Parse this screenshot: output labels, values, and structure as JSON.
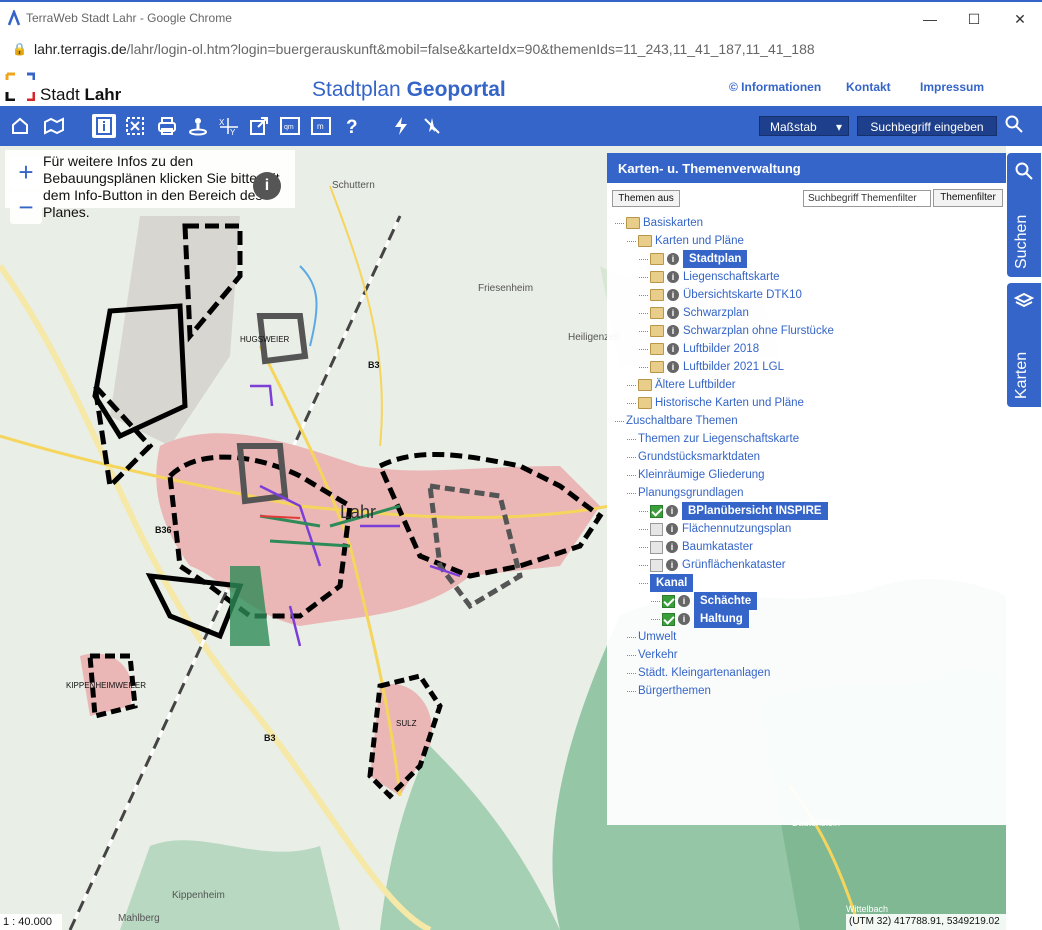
{
  "browser": {
    "window_title": "TerraWeb Stadt Lahr - Google Chrome",
    "url_host": "lahr.terragis.de",
    "url_rest": "/lahr/login-ol.htm?login=buergerauskunft&mobil=false&karteIdx=90&themenIds=11_243,11_41_187,11_41_188"
  },
  "header": {
    "site_name_prefix": "Stadt",
    "site_name_bold": "Lahr",
    "portal_prefix": "Stadtplan",
    "portal_bold": "Geoportal",
    "links": [
      "© Informationen",
      "Kontakt",
      "Impressum"
    ]
  },
  "toolbar": {
    "scale_label": "Maßstab",
    "search_label": "Suchbegriff eingeben",
    "icons": [
      "home-icon",
      "zoom-extent-icon",
      "info-icon",
      "select-area-icon",
      "print-icon",
      "locate-person-icon",
      "coordinates-icon",
      "export-icon",
      "area-measure-icon",
      "distance-measure-icon",
      "help-icon",
      "flash-icon",
      "gps-off-icon"
    ]
  },
  "map": {
    "info_text": "Für weitere Infos zu den Bebauungsplänen klicken Sie bitte mit dem Info-Button in den Bereich des Planes.",
    "zoom_in": "+",
    "zoom_out": "−",
    "scale": "1 : 40.000",
    "coordinates": "(UTM 32) 417788.91, 5349219.02",
    "place_labels": [
      "Schuttern",
      "Friesenheim",
      "Heiligenzell",
      "HUGSWEIER",
      "Lahr",
      "KIPPENHEIMWEILER",
      "SULZ",
      "Kippenheim",
      "Mahlberg",
      "Dautenstein",
      "Wittelbach",
      "B3",
      "B36",
      "B3"
    ]
  },
  "panel": {
    "title": "Karten- u. Themenverwaltung",
    "themes_off": "Themen aus",
    "filter_placeholder": "Suchbegriff Themenfilter",
    "filter_button": "Themenfilter",
    "tree": [
      {
        "label": "Basiskarten",
        "level": 0,
        "folder": true
      },
      {
        "label": "Karten und Pläne",
        "level": 1,
        "folder": true
      },
      {
        "label": "Stadtplan",
        "level": 2,
        "folder": true,
        "info": true,
        "selected": true
      },
      {
        "label": "Liegenschaftskarte",
        "level": 2,
        "folder": true,
        "info": true
      },
      {
        "label": "Übersichtskarte DTK10",
        "level": 2,
        "folder": true,
        "info": true
      },
      {
        "label": "Schwarzplan",
        "level": 2,
        "folder": true,
        "info": true
      },
      {
        "label": "Schwarzplan ohne Flurstücke",
        "level": 2,
        "folder": true,
        "info": true
      },
      {
        "label": "Luftbilder 2018",
        "level": 2,
        "folder": true,
        "info": true
      },
      {
        "label": "Luftbilder 2021 LGL",
        "level": 2,
        "folder": true,
        "info": true
      },
      {
        "label": "Ältere Luftbilder",
        "level": 1,
        "folder": true
      },
      {
        "label": "Historische Karten und Pläne",
        "level": 1,
        "folder": true
      },
      {
        "label": "Zuschaltbare Themen",
        "level": 0
      },
      {
        "label": "Themen zur Liegenschaftskarte",
        "level": 1
      },
      {
        "label": "Grundstücksmarktdaten",
        "level": 1
      },
      {
        "label": "Kleinräumige Gliederung",
        "level": 1
      },
      {
        "label": "Planungsgrundlagen",
        "level": 1
      },
      {
        "label": "BPlanübersicht INSPIRE",
        "level": 2,
        "check": true,
        "checked": true,
        "info": true,
        "selected": true
      },
      {
        "label": "Flächennutzungsplan",
        "level": 2,
        "check": true,
        "info": true
      },
      {
        "label": "Baumkataster",
        "level": 2,
        "check": true,
        "info": true
      },
      {
        "label": "Grünflächenkataster",
        "level": 2,
        "check": true,
        "info": true
      },
      {
        "label": "Kanal",
        "level": 2,
        "selected": true
      },
      {
        "label": "Schächte",
        "level": 3,
        "check": true,
        "checked": true,
        "info": true,
        "selected": true
      },
      {
        "label": "Haltung",
        "level": 3,
        "check": true,
        "checked": true,
        "info": true,
        "selected": true
      },
      {
        "label": "Umwelt",
        "level": 1
      },
      {
        "label": "Verkehr",
        "level": 1
      },
      {
        "label": "Städt. Kleingartenanlagen",
        "level": 1
      },
      {
        "label": "Bürgerthemen",
        "level": 1
      }
    ]
  },
  "side_tabs": [
    "Suchen",
    "Karten"
  ]
}
